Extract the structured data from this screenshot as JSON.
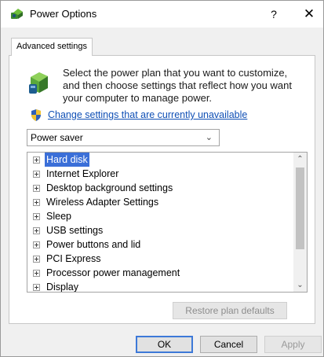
{
  "window": {
    "title": "Power Options",
    "help_label": "?",
    "close_label": "✕"
  },
  "tabs": [
    {
      "label": "Advanced settings",
      "active": true
    }
  ],
  "description": "Select the power plan that you want to customize, and then choose settings that reflect how you want your computer to manage power.",
  "change_link": "Change settings that are currently unavailable",
  "plan_select": {
    "value": "Power saver",
    "chevron": "⌄"
  },
  "tree": {
    "items": [
      {
        "label": "Hard disk",
        "selected": true
      },
      {
        "label": "Internet Explorer",
        "selected": false
      },
      {
        "label": "Desktop background settings",
        "selected": false
      },
      {
        "label": "Wireless Adapter Settings",
        "selected": false
      },
      {
        "label": "Sleep",
        "selected": false
      },
      {
        "label": "USB settings",
        "selected": false
      },
      {
        "label": "Power buttons and lid",
        "selected": false
      },
      {
        "label": "PCI Express",
        "selected": false
      },
      {
        "label": "Processor power management",
        "selected": false
      },
      {
        "label": "Display",
        "selected": false
      }
    ],
    "scroll_up": "⌃",
    "scroll_down": "⌄"
  },
  "buttons": {
    "restore": "Restore plan defaults",
    "ok": "OK",
    "cancel": "Cancel",
    "apply": "Apply"
  },
  "colors": {
    "link": "#0f4fb5",
    "selection": "#3b6fd8",
    "default_button_border": "#3d79d8"
  }
}
